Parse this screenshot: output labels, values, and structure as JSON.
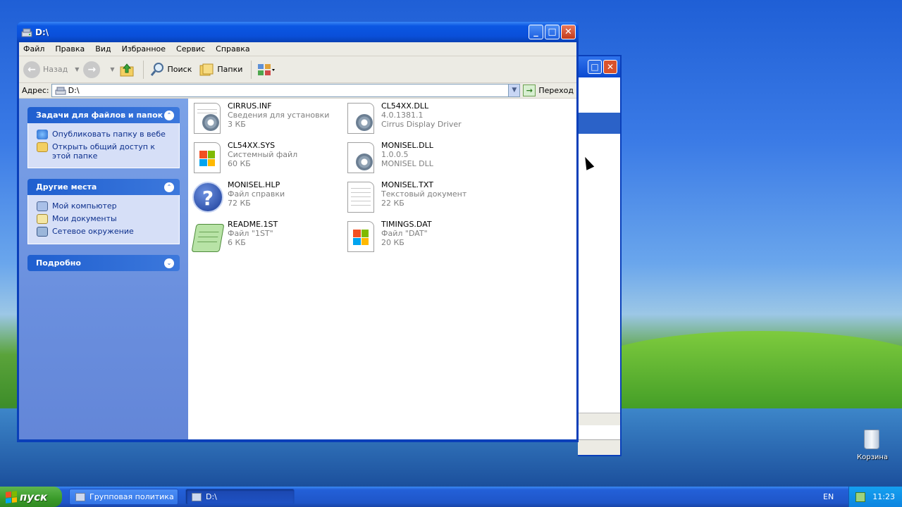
{
  "window": {
    "title": "D:\\",
    "menu": [
      "Файл",
      "Правка",
      "Вид",
      "Избранное",
      "Сервис",
      "Справка"
    ],
    "toolbar": {
      "back_label": "Назад",
      "search_label": "Поиск",
      "folders_label": "Папки"
    },
    "address": {
      "label": "Адрес:",
      "value": "D:\\",
      "go_label": "Переход"
    }
  },
  "tasks": {
    "file_tasks": {
      "title": "Задачи для файлов и папок",
      "items": [
        "Опубликовать папку в вебе",
        "Открыть общий доступ к этой папке"
      ]
    },
    "other_places": {
      "title": "Другие места",
      "items": [
        "Мой компьютер",
        "Мои документы",
        "Сетевое окружение"
      ]
    },
    "details": {
      "title": "Подробно"
    }
  },
  "files": [
    {
      "name": "CIRRUS.INF",
      "line2": "Сведения для установки",
      "line3": "3 КБ",
      "icon": "inf-settings-icon"
    },
    {
      "name": "CL54XX.DLL",
      "line2": "4.0.1381.1",
      "line3": "Cirrus Display Driver",
      "icon": "dll-gear-icon"
    },
    {
      "name": "CL54XX.SYS",
      "line2": "Системный файл",
      "line3": "60 КБ",
      "icon": "system-file-icon"
    },
    {
      "name": "MONISEL.DLL",
      "line2": "1.0.0.5",
      "line3": "MONISEL DLL",
      "icon": "dll-gear-icon"
    },
    {
      "name": "MONISEL.HLP",
      "line2": "Файл справки",
      "line3": "72 КБ",
      "icon": "help-file-icon"
    },
    {
      "name": "MONISEL.TXT",
      "line2": "Текстовый документ",
      "line3": "22 КБ",
      "icon": "text-document-icon"
    },
    {
      "name": "README.1ST",
      "line2": "Файл \"1ST\"",
      "line3": "6 КБ",
      "icon": "notepad-file-icon"
    },
    {
      "name": "TIMINGS.DAT",
      "line2": "Файл \"DAT\"",
      "line3": "20 КБ",
      "icon": "system-file-icon"
    }
  ],
  "desktop": {
    "recycle_bin_label": "Корзина"
  },
  "taskbar": {
    "start_label": "пуск",
    "tasks": [
      "Групповая политика",
      "D:\\"
    ],
    "language": "EN",
    "clock": "11:23"
  },
  "colors": {
    "title_blue": "#0a4fd9",
    "task_pane": "#6a8fde",
    "link_text": "#0c2f8c",
    "start_green": "#3a9b2a"
  }
}
